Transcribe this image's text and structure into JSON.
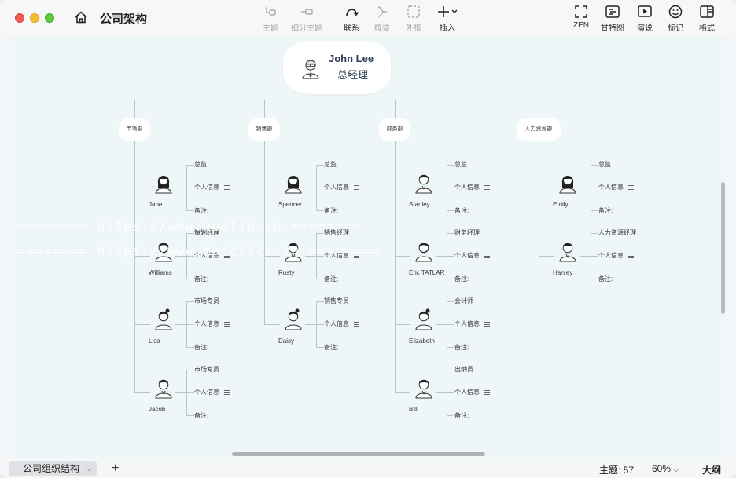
{
  "window": {
    "title": "公司架构"
  },
  "toolbar": {
    "topic": "主题",
    "subtopic": "细分主题",
    "relationship": "联系",
    "summary": "概要",
    "boundary": "外框",
    "insert": "插入",
    "zen": "ZEN",
    "gantt": "甘特图",
    "present": "演说",
    "marker": "标记",
    "format": "格式"
  },
  "root": {
    "name": "John Lee",
    "title": "总经理"
  },
  "labels": {
    "info": "个人信息",
    "note": "备注:"
  },
  "departments": [
    {
      "name": "市场部",
      "people": [
        {
          "name": "Jane",
          "role": "总监"
        },
        {
          "name": "Williams",
          "role": "策划经理"
        },
        {
          "name": "Lisa",
          "role": "市场专员"
        },
        {
          "name": "Jacob",
          "role": "市场专员"
        }
      ]
    },
    {
      "name": "销售部",
      "people": [
        {
          "name": "Spencer",
          "role": "总监"
        },
        {
          "name": "Rusty",
          "role": "销售经理"
        },
        {
          "name": "Daisy",
          "role": "销售专员"
        }
      ]
    },
    {
      "name": "财务部",
      "people": [
        {
          "name": "Stanley",
          "role": "总监"
        },
        {
          "name": "Eric TATLAR",
          "role": "财务经理"
        },
        {
          "name": "Elizabeth",
          "role": "会计师"
        },
        {
          "name": "Bill",
          "role": "出纳员"
        }
      ]
    },
    {
      "name": "人力资源部",
      "people": [
        {
          "name": "Emily",
          "role": "总监"
        },
        {
          "name": "Harvey",
          "role": "人力资源经理"
        }
      ]
    }
  ],
  "watermark": {
    "line1": "======== https://www.hoolin.cn ========",
    "line2": "======== https://www.macclick.cn ========"
  },
  "bottom": {
    "sheet": "公司组织结构",
    "add": "+",
    "topics": "主题: 57",
    "zoom": "60%",
    "outline": "大纲"
  }
}
